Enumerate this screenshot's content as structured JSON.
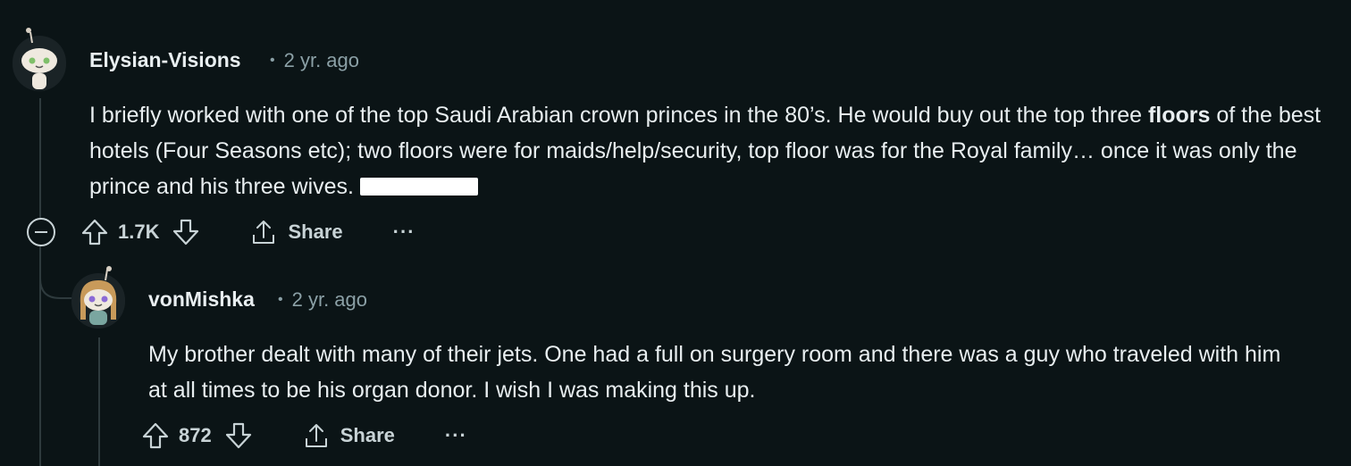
{
  "comments": [
    {
      "author": "Elysian-Visions",
      "time": "2 yr. ago",
      "separator": "•",
      "body_part1": "I briefly worked with one of the top Saudi Arabian crown princes in the 80’s. He would buy out the top three ",
      "body_bold": "floors",
      "body_part2": " of the best hotels (Four Seasons etc); two floors were for maids/help/security, top floor was for the Royal family… once it was only the prince and his three wives. ",
      "votes": "1.7K",
      "share_label": "Share",
      "more_label": "···"
    },
    {
      "author": "vonMishka",
      "time": "2 yr. ago",
      "separator": "•",
      "body": "My brother dealt with many of their jets. One had a full on surgery room and there was a guy who traveled with him at all times to be his organ donor. I wish I was making this up.",
      "votes": "872",
      "share_label": "Share",
      "more_label": "···"
    }
  ],
  "icons": {
    "upvote": "arrow-up-icon",
    "downvote": "arrow-down-icon",
    "share": "share-icon",
    "collapse": "collapse-minus-icon"
  },
  "colors": {
    "background": "#0b1416",
    "text": "#e8eef0",
    "meta": "#8ba0a6",
    "thread_line": "#2e3a3d"
  }
}
